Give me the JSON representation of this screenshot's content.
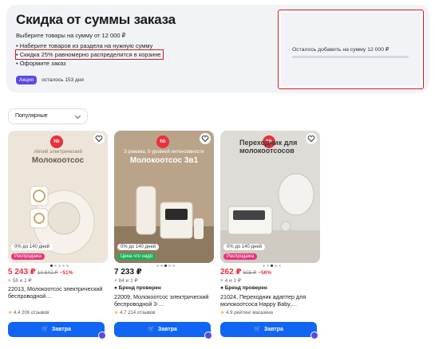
{
  "promo": {
    "title": "Скидка от суммы заказа",
    "subtitle": "Выберите товары на сумму от 12 000 ₽",
    "steps": [
      "Наберите товаров из раздела на нужную сумму",
      "Скидка 25% равномерно распределится в корзине",
      "Оформите заказ"
    ],
    "badge": "Акция",
    "days_left": "осталось 153 дня"
  },
  "progress": {
    "text": "Осталось добавить на сумму 12 000 ₽",
    "fraction": 0
  },
  "sort": {
    "value": "Популярные"
  },
  "products": [
    {
      "logo": "hb",
      "img_small": "лёгкий электрический",
      "img_big": "Молокоотсос",
      "installment": "0% до 140 дней",
      "promo_chip": "Распродажа",
      "promo_color": "#e6347a",
      "price": "5 243 ₽",
      "price_old": "10 842 ₽",
      "discount": "−51%",
      "bonus": "+ 58 и 1 ₽",
      "brand": "",
      "title": "22013, Молокоотсос электрический беспроводной…",
      "rating": "4.4",
      "reviews": "206 отзывов",
      "button": "Завтра",
      "image_bg": "#ede5da"
    },
    {
      "logo": "hb",
      "img_small": "3 режима, 9 уровней интенсивности",
      "img_big": "Молокоотсос 3в1",
      "installment": "0% до 140 дней",
      "promo_chip": "Цена что надо",
      "promo_color": "#17b35a",
      "price": "7 233 ₽",
      "price_old": "",
      "discount": "",
      "bonus": "+ 84 и 1 ₽",
      "brand": "Бренд проверен",
      "title": "22009, Молокоотсос электрический беспроводной 3-…",
      "rating": "4.7",
      "reviews": "214 отзывов",
      "button": "Завтра",
      "image_bg": "#b9a48a"
    },
    {
      "logo": "hb",
      "img_small": "",
      "img_big": "Переходник для молокоотсосов",
      "installment": "0% до 140 дней",
      "promo_chip": "Распродажа",
      "promo_color": "#e6347a",
      "price": "262 ₽",
      "price_old": "605 ₽",
      "discount": "−56%",
      "bonus": "+ 4 и 1 ₽",
      "brand": "Бренд проверен",
      "title": "21024, Переходник адаптер для молокоотсоса Happy Baby,…",
      "rating": "4.9",
      "reviews": "рейтинг магазина",
      "button": "Завтра",
      "image_bg": "#dedcd7"
    }
  ]
}
